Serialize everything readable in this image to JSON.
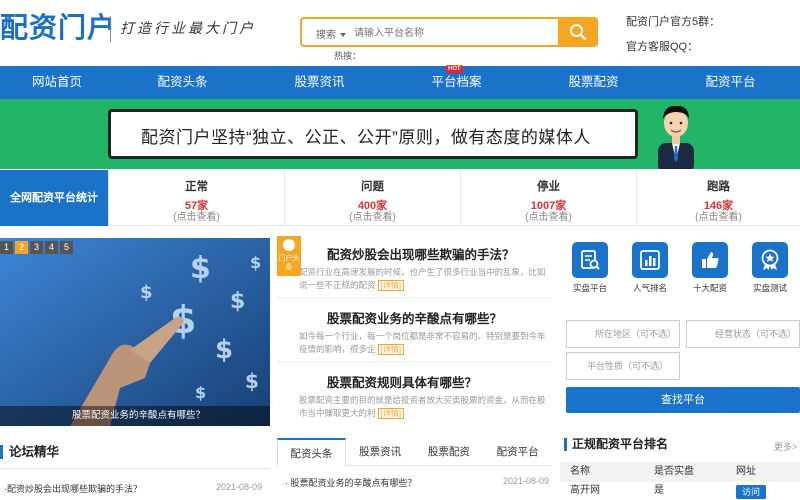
{
  "header": {
    "logo": "配资门户",
    "slogan": "打造行业最大门户",
    "search_type": "搜索",
    "search_placeholder": "请输入平台名称",
    "hot_label": "热搜：",
    "qq_group": "配资门户官方5群：",
    "qq_service": "官方客服QQ："
  },
  "nav": {
    "items": [
      "网站首页",
      "配资头条",
      "股票资讯",
      "平台档案",
      "股票配资",
      "配资平台"
    ],
    "hot_badge": "HOT"
  },
  "banner": {
    "text": "配资门户坚持“独立、公正、公开”原则，做有态度的媒体人"
  },
  "stats": {
    "title": "全网配资平台统计",
    "items": [
      {
        "label": "正常",
        "count": "57家",
        "hint": "(点击查看)"
      },
      {
        "label": "问题",
        "count": "400家",
        "hint": "(点击查看)"
      },
      {
        "label": "停业",
        "count": "1007家",
        "hint": "(点击查看)"
      },
      {
        "label": "跑路",
        "count": "146家",
        "hint": "(点击查看)"
      }
    ]
  },
  "slider": {
    "pages": [
      "1",
      "2",
      "3",
      "4",
      "5"
    ],
    "active_page": 1,
    "caption": "股票配资业务的辛酸点有哪些？"
  },
  "articles": {
    "badge": "门户头条",
    "items": [
      {
        "title": "配资炒股会出现哪些欺骗的手法？",
        "summary": "配资行业在高速发展的时候，也产生了很多行业当中的乱象，比如说一些不正规的配资",
        "more": "[详情]"
      },
      {
        "title": "股票配资业务的辛酸点有哪些？",
        "summary": "如今每一个行业，每一个岗位都是非常不容易的。特别是要到今年疫情的影响，很多企",
        "more": "[详情]"
      },
      {
        "title": "股票配资规则具体有哪些？",
        "summary": "股票配资主要的目的就是给投资者放大买卖股票的资金，从而在股市当中赚取更大的利",
        "more": "[详情]"
      }
    ]
  },
  "tools": [
    {
      "label": "实盘平台",
      "icon": "search-doc-icon"
    },
    {
      "label": "人气排名",
      "icon": "chart-doc-icon"
    },
    {
      "label": "十大配资",
      "icon": "thumbs-up-icon"
    },
    {
      "label": "实盘测试",
      "icon": "badge-star-icon"
    }
  ],
  "filter": {
    "region": "所在地区（可不选）",
    "status": "经营状态（可不选）",
    "nature": "平台性质（可不选）",
    "button": "查找平台"
  },
  "forum": {
    "title": "论坛精华",
    "item": "·配资炒股会出现哪些欺骗的手法？",
    "date": "2021-08-09"
  },
  "tabs": {
    "items": [
      "配资头条",
      "股票资讯",
      "股票配资",
      "配资平台"
    ],
    "item": "· 股票配资业务的辛酸点有哪些？",
    "date": "2021-08-09"
  },
  "ranking": {
    "title": "正规配资平台排名",
    "more": "更多>",
    "headers": [
      "名称",
      "是否实盘",
      "网址"
    ],
    "row": {
      "name": "高开网",
      "real": "是",
      "action": "访问"
    }
  },
  "colors": {
    "primary": "#1a73c9",
    "accent": "#f5a623",
    "banner": "#22b567",
    "alert": "#dd3333"
  }
}
